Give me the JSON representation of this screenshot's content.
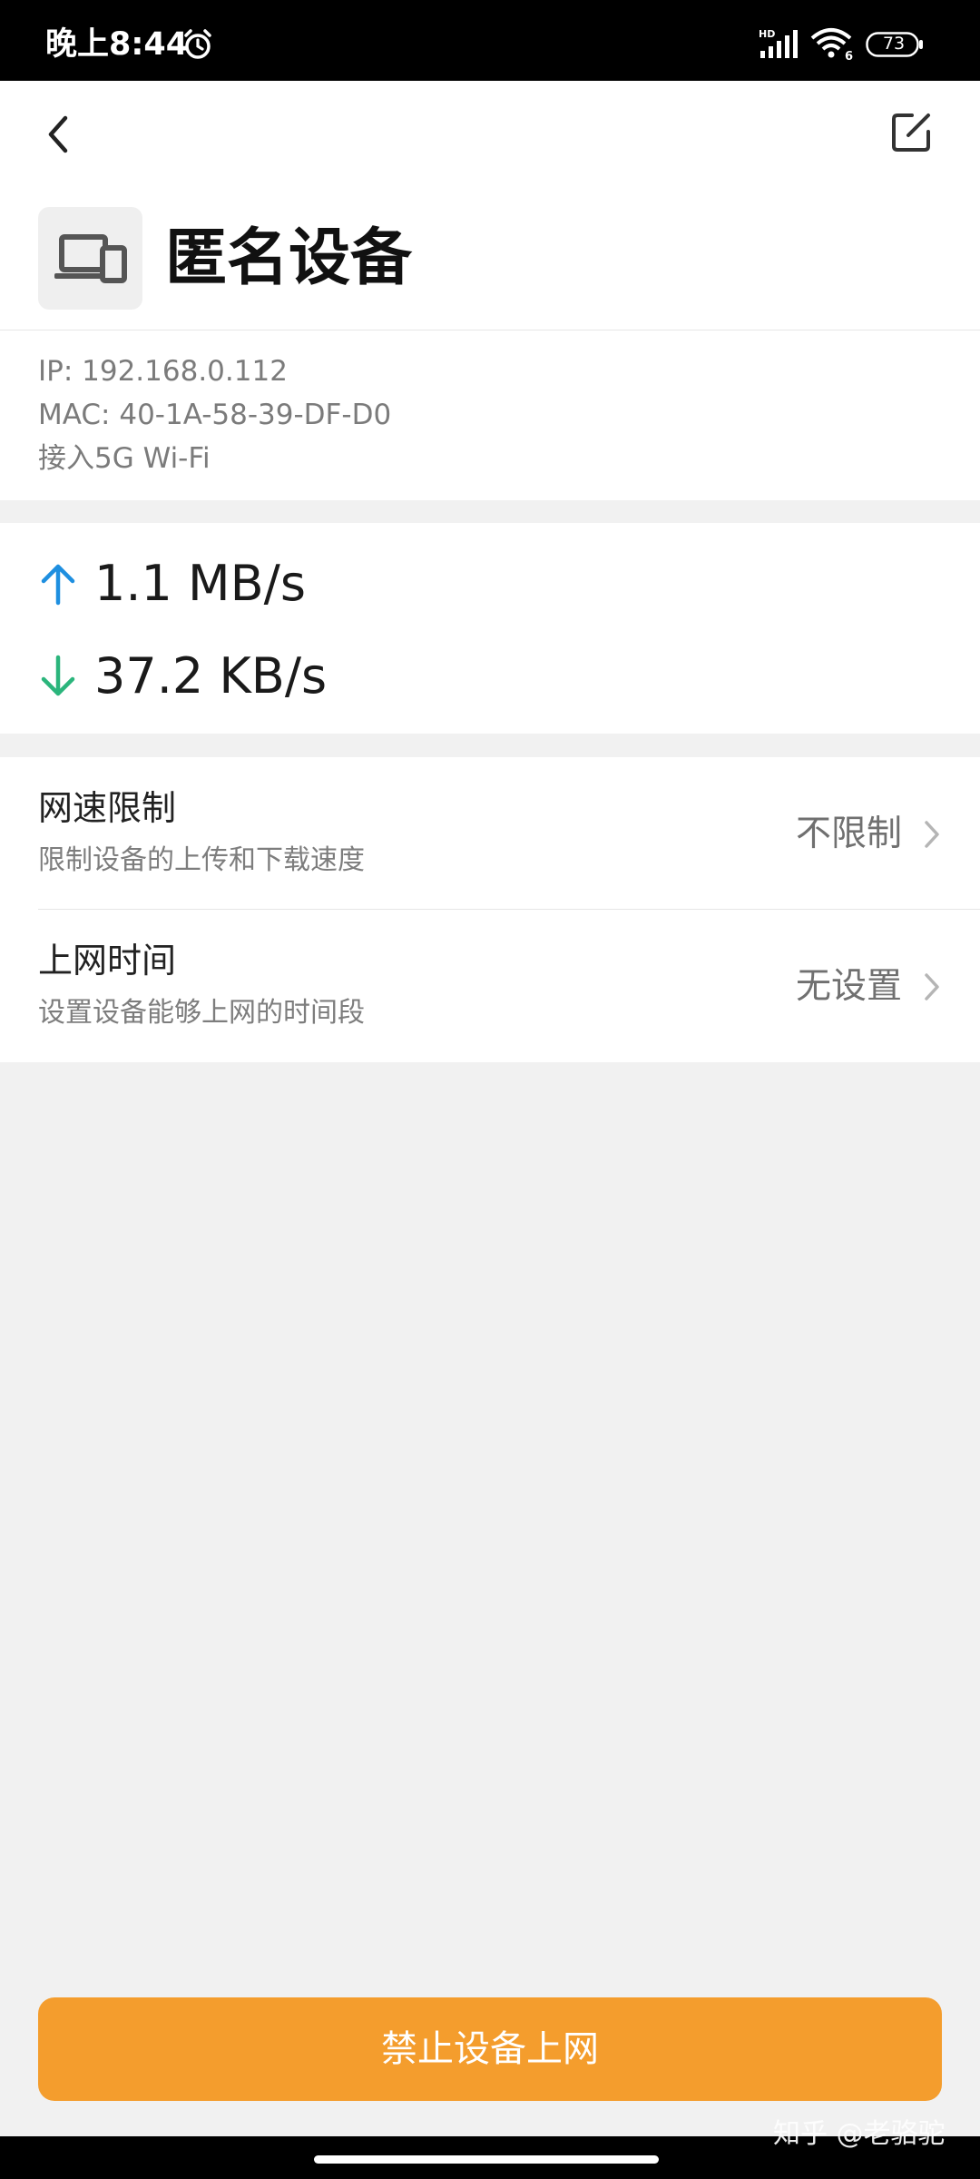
{
  "status_bar": {
    "time": "晚上8:44",
    "network_label": "HD",
    "wifi_label": "6",
    "battery": "73",
    "icons": [
      "alarm-icon",
      "signal-icon",
      "wifi-icon",
      "battery-icon"
    ]
  },
  "header": {
    "back_icon": "back-arrow-icon",
    "edit_icon": "edit-icon"
  },
  "device": {
    "icon": "devices-icon",
    "name": "匿名设备",
    "ip": "IP: 192.168.0.112",
    "mac": "MAC: 40-1A-58-39-DF-D0",
    "connection": "接入5G Wi-Fi"
  },
  "traffic": {
    "upload": "1.1 MB/s",
    "download": "37.2 KB/s",
    "upload_color": "#1e8fe0",
    "download_color": "#2bb57c"
  },
  "settings": [
    {
      "title": "网速限制",
      "subtitle": "限制设备的上传和下载速度",
      "value": "不限制"
    },
    {
      "title": "上网时间",
      "subtitle": "设置设备能够上网的时间段",
      "value": "无设置"
    }
  ],
  "action": {
    "label": "禁止设备上网",
    "color": "#f49d2d"
  },
  "watermark": "知乎 @老骆驼"
}
